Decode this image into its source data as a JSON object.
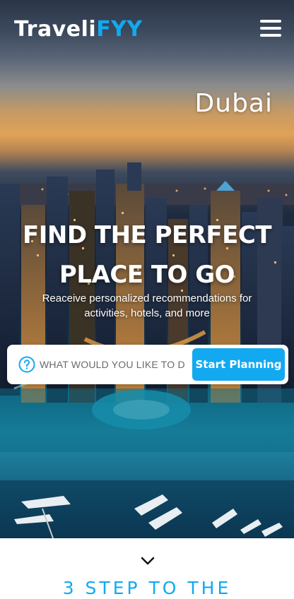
{
  "brand": {
    "name_main": "Traveli",
    "name_accent": "FYY",
    "accent_color": "#12a9f0"
  },
  "hero": {
    "city": "Dubai",
    "headline_line1": "FIND THE PERFECT",
    "headline_line2": "PLACE TO GO",
    "subline_line1": "Reaceive personalized recommendations for",
    "subline_line2": "activities, hotels, and more"
  },
  "search": {
    "placeholder": "WHAT WOULD YOU LIKE TO DO?",
    "button_label": "Start Planning",
    "help_icon": "question-circle-icon"
  },
  "nav": {
    "menu_icon": "hamburger-menu-icon"
  },
  "section": {
    "scroll_icon": "chevron-down-icon",
    "title": "3 STEP TO THE"
  }
}
